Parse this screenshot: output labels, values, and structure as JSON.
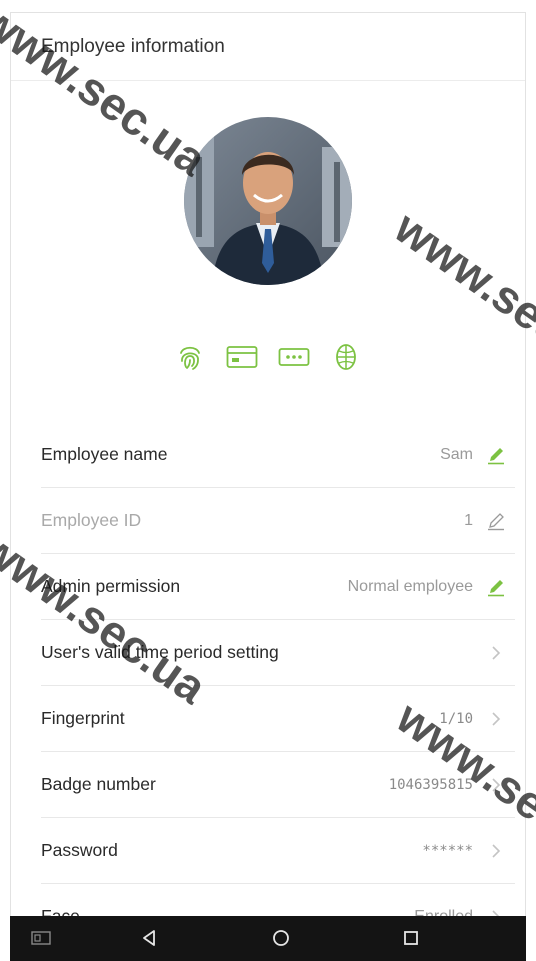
{
  "header": {
    "title": "Employee information"
  },
  "avatar": {
    "alt": "Employee photo"
  },
  "verification_methods": [
    "fingerprint-icon",
    "card-icon",
    "password-icon",
    "face-icon"
  ],
  "fields": [
    {
      "key": "employee_name",
      "label": "Employee name",
      "value": "Sam",
      "action": "edit",
      "enabled": true
    },
    {
      "key": "employee_id",
      "label": "Employee ID",
      "value": "1",
      "action": "edit",
      "enabled": false
    },
    {
      "key": "admin_permission",
      "label": "Admin permission",
      "value": "Normal employee",
      "action": "edit",
      "enabled": true
    },
    {
      "key": "valid_time",
      "label": "User's valid time period setting",
      "value": "",
      "action": "chevron",
      "enabled": true
    },
    {
      "key": "fingerprint",
      "label": "Fingerprint",
      "value": "1/10",
      "action": "chevron",
      "enabled": true
    },
    {
      "key": "badge_number",
      "label": "Badge number",
      "value": "1046395815",
      "action": "chevron",
      "enabled": true
    },
    {
      "key": "password",
      "label": "Password",
      "value": "******",
      "action": "chevron",
      "enabled": true
    },
    {
      "key": "face",
      "label": "Face",
      "value": "Enrolled",
      "action": "chevron",
      "enabled": true
    }
  ],
  "navbar": {
    "items": [
      "screenshot-icon",
      "back-icon",
      "home-icon",
      "recents-icon"
    ]
  },
  "watermarks": [
    "www.sec.ua",
    "www.sec.ua",
    "www.sec.ua",
    "www.sec.ua"
  ],
  "colors": {
    "accent": "#7cc242",
    "disabled": "#a9a9a9",
    "navbar": "#141414"
  }
}
